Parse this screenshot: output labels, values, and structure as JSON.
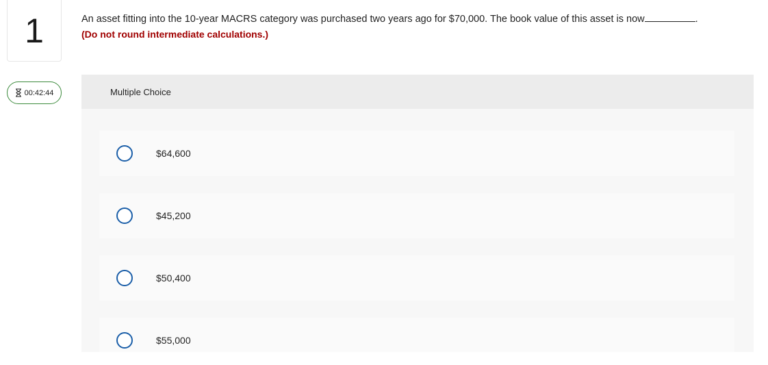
{
  "question": {
    "number": "1",
    "text": "An asset fitting into the 10-year MACRS category was purchased two years ago for $70,000. The book value of this asset is now",
    "trailing": ".",
    "note": "(Do not round intermediate calculations.)"
  },
  "timer": {
    "value": "00:42:44",
    "icon": "hourglass-icon",
    "color": "#3d8b3d"
  },
  "choice_section": {
    "header": "Multiple Choice",
    "options": [
      {
        "label": "$64,600"
      },
      {
        "label": "$45,200"
      },
      {
        "label": "$50,400"
      },
      {
        "label": "$55,000"
      }
    ]
  },
  "colors": {
    "note": "#a00000",
    "radio_border": "#1a5ea8",
    "panel_background": "#f7f7f7",
    "header_background": "#ececec"
  }
}
